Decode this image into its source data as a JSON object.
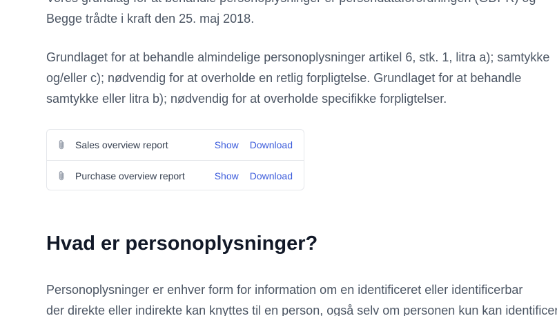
{
  "article": {
    "intro_lines": [
      "Vores grundlag for at behandle personoplysninger er persondataforordningen (GDPR) og",
      "Begge trådte i kraft den 25. maj 2018."
    ],
    "legal_lines": [
      "Grundlaget for at behandle almindelige personoplysninger artikel 6, stk. 1, litra a); samtykke",
      "og/eller c); nødvendig for at overholde en retlig forpligtelse. Grundlaget for at behandle",
      "samtykke eller litra b); nødvendig for at overholde specifikke forpligtelser."
    ],
    "attachments": [
      {
        "name": "Sales overview report",
        "show_label": "Show",
        "download_label": "Download",
        "icon": "paperclip-icon"
      },
      {
        "name": "Purchase overview report",
        "show_label": "Show",
        "download_label": "Download",
        "icon": "paperclip-icon"
      }
    ],
    "heading": "Hvad er personoplysninger?",
    "definition_lines": [
      "Personoplysninger er enhver form for information om en identificeret eller identificerbar",
      "der direkte eller indirekte kan knyttes til en person, også selv om personen kun kan identificeres"
    ]
  },
  "colors": {
    "link": "#3b5bdb",
    "text": "#4b5563",
    "heading": "#111827",
    "border": "#e5e7eb"
  }
}
